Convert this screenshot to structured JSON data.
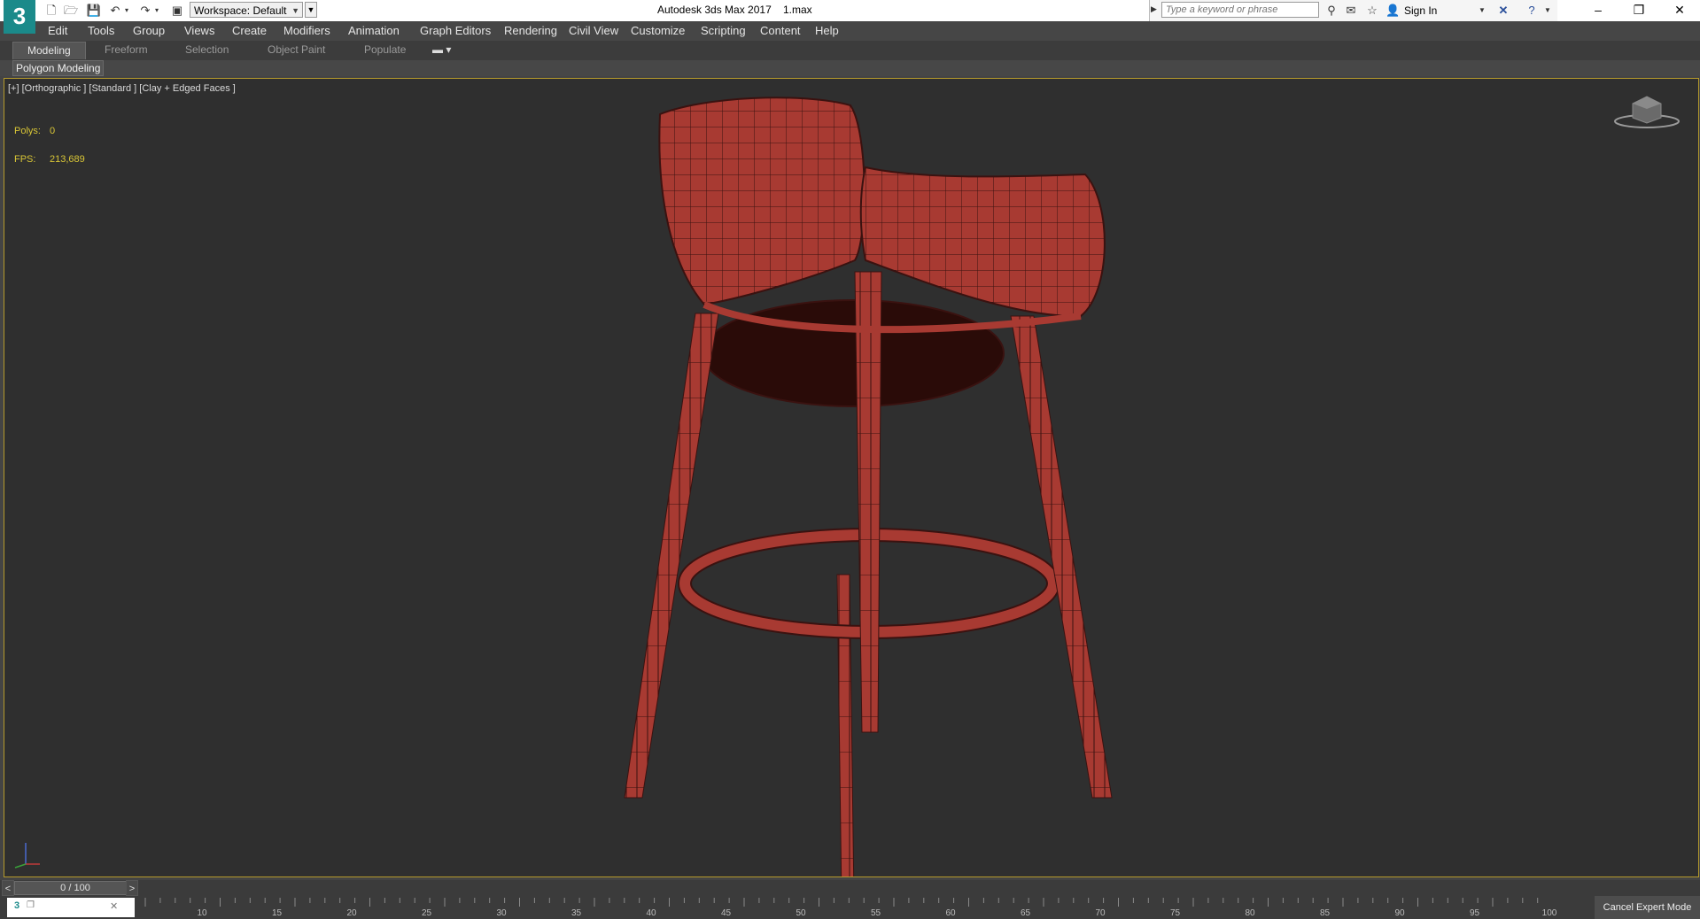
{
  "titlebar": {
    "app_title": "Autodesk 3ds Max 2017",
    "file_name": "1.max",
    "workspace": "Workspace: Default",
    "search_placeholder": "Type a keyword or phrase",
    "sign_in": "Sign In",
    "logo": "3"
  },
  "menu": [
    "Edit",
    "Tools",
    "Group",
    "Views",
    "Create",
    "Modifiers",
    "Animation",
    "Graph Editors",
    "Rendering",
    "Civil View",
    "Customize",
    "Scripting",
    "Content",
    "Help"
  ],
  "ribbon": {
    "tabs": [
      "Modeling",
      "Freeform",
      "Selection",
      "Object Paint",
      "Populate"
    ],
    "active_tab": "Modeling",
    "panel_button": "Polygon Modeling"
  },
  "viewport": {
    "label": "[+] [Orthographic ] [Standard ] [Clay + Edged Faces ]",
    "stats": {
      "polys_label": "Polys:",
      "polys_value": "0",
      "fps_label": "FPS:",
      "fps_value": "213,689"
    },
    "highlight_color": "#b59a2b",
    "model_color": "#a83a32"
  },
  "time_slider": {
    "label": "0 / 100",
    "prev": "<",
    "next": ">"
  },
  "timeline": {
    "ticks": [
      "10",
      "15",
      "20",
      "25",
      "30",
      "35",
      "40",
      "45",
      "50",
      "55",
      "60",
      "65",
      "70",
      "75",
      "80",
      "85",
      "90",
      "95",
      "100"
    ],
    "expert_mode_button": "Cancel Expert Mode"
  }
}
